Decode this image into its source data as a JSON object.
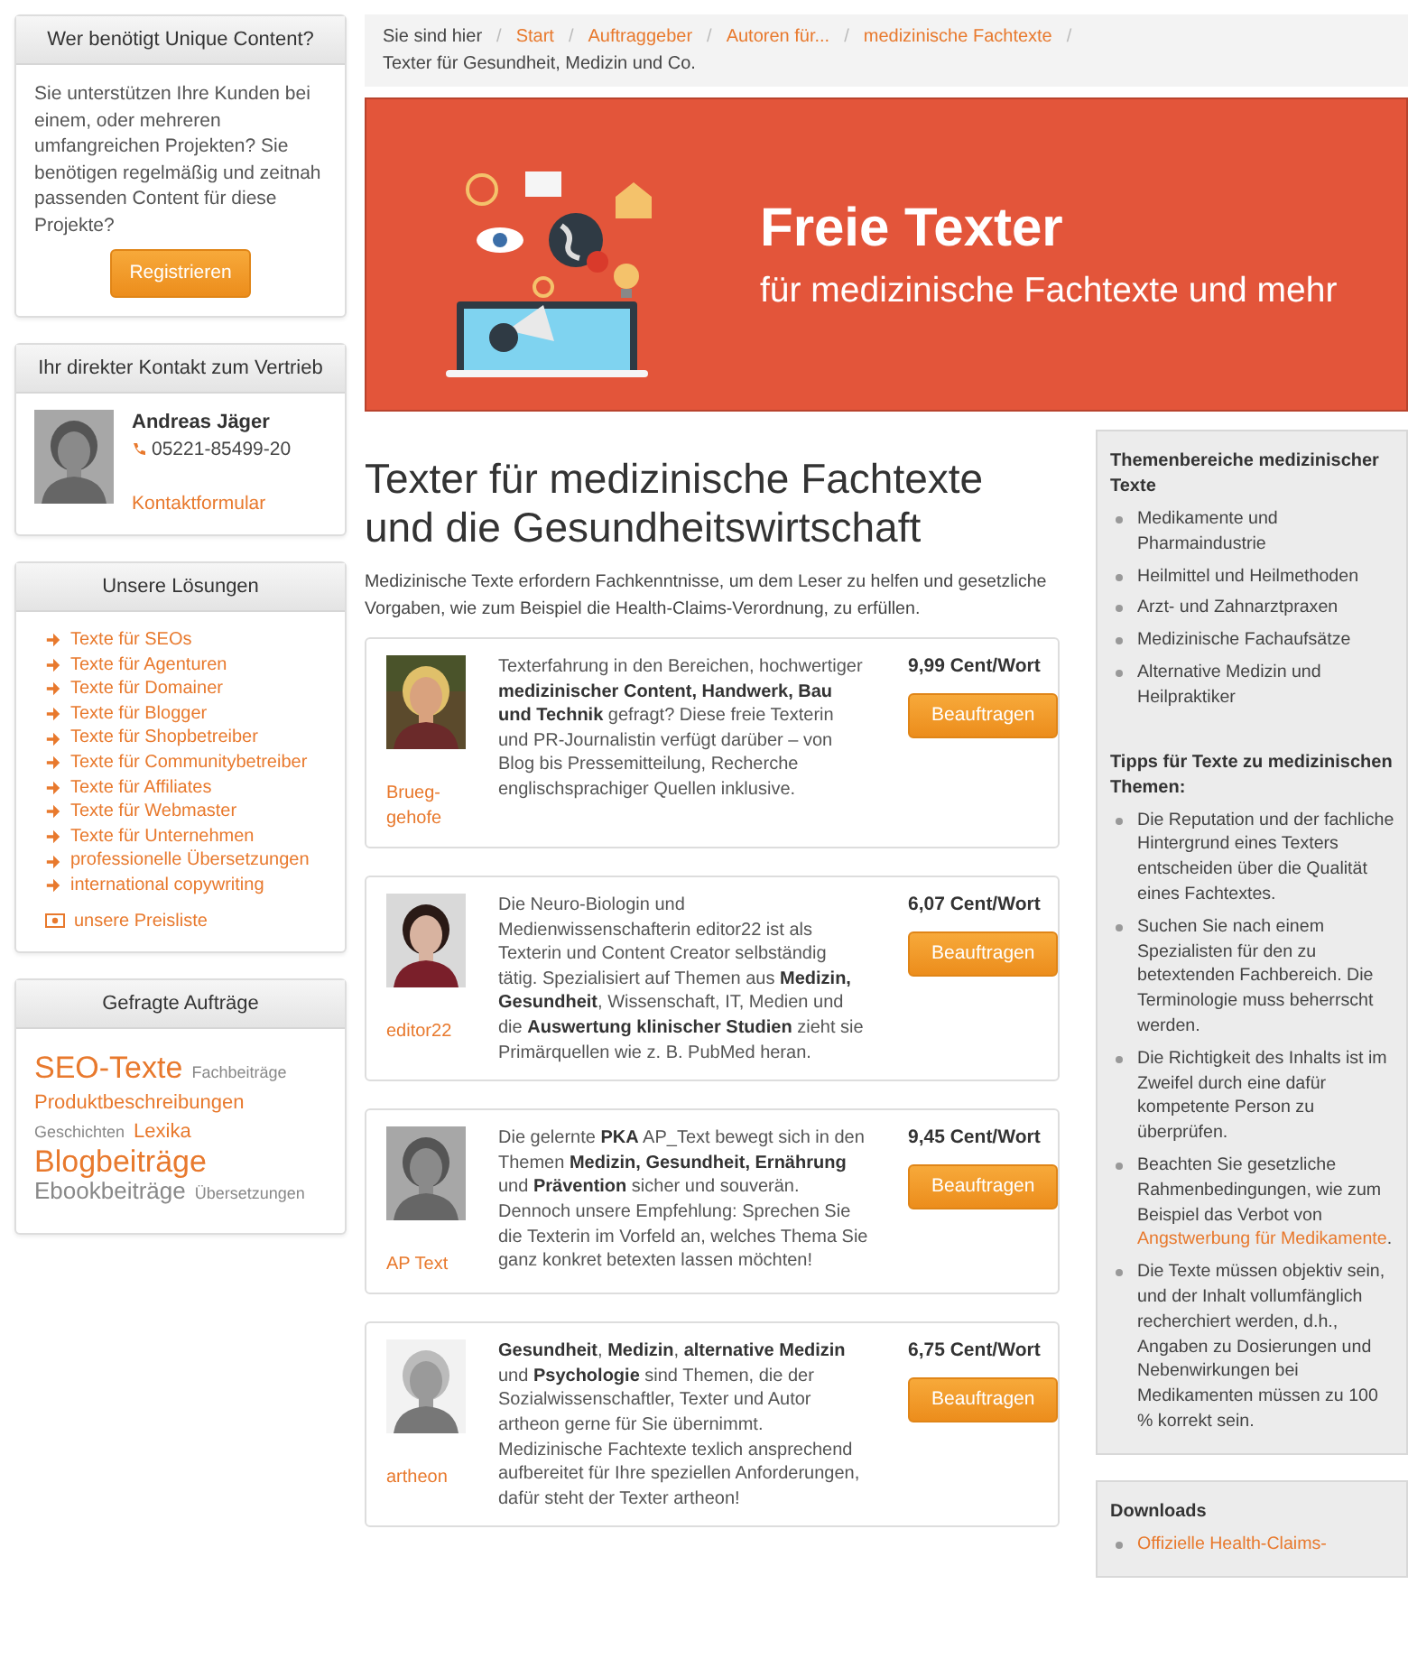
{
  "sidebar_panels": [
    {
      "kind": "promo",
      "title": "Wer benötigt Unique Content?",
      "text": "Sie unterstützen Ihre Kunden bei einem, oder mehreren umfangreichen Projekten? Sie benötigen regelmäßig und zeitnah passenden Content für diese Projekte?",
      "button": "Registrieren"
    },
    {
      "kind": "contact",
      "title": "Ihr direkter Kontakt zum Vertrieb",
      "name": "Andreas Jäger",
      "phone": "05221-85499-20",
      "link": "Kontaktformular"
    },
    {
      "kind": "links",
      "title": "Unsere Lösungen",
      "items": [
        {
          "kind": "arrow",
          "label": "Texte für SEOs"
        },
        {
          "kind": "arrow",
          "label": "Texte für Agenturen"
        },
        {
          "kind": "arrow",
          "label": "Texte für Domainer"
        },
        {
          "kind": "arrow",
          "label": "Texte für Blogger"
        },
        {
          "kind": "arrow",
          "label": "Texte für Shopbetreiber"
        },
        {
          "kind": "arrow",
          "label": "Texte für Communitybetreiber"
        },
        {
          "kind": "arrow",
          "label": "Texte für Affiliates"
        },
        {
          "kind": "arrow",
          "label": "Texte für Webmaster"
        },
        {
          "kind": "arrow",
          "label": "Texte für Unternehmen"
        },
        {
          "kind": "arrow",
          "label": "professionelle Übersetzungen"
        },
        {
          "kind": "arrow",
          "label": "international copywriting"
        },
        {
          "kind": "price",
          "label": "unsere Preisliste"
        }
      ]
    },
    {
      "kind": "tags",
      "title": "Gefragte Aufträge",
      "tags": [
        {
          "label": "SEO-Texte",
          "kind": "large",
          "color": "#e8792d"
        },
        {
          "label": "Fachbeiträge",
          "kind": "small",
          "color": "#888888"
        },
        {
          "label": "Produktbeschreibungen",
          "kind": "medium",
          "color": "#e8792d"
        },
        {
          "label": "Geschichten",
          "kind": "small",
          "color": "#888888"
        },
        {
          "label": "Lexika",
          "kind": "medium",
          "color": "#e8792d"
        },
        {
          "label": "Blogbeiträge",
          "kind": "large",
          "color": "#e8792d"
        },
        {
          "label": "Ebookbeiträge",
          "kind": "mediumlarge",
          "color": "#888888"
        },
        {
          "label": "Übersetzungen",
          "kind": "small",
          "color": "#888888"
        }
      ]
    }
  ],
  "breadcrumb": {
    "prefix": "Sie sind hier",
    "separator": "/",
    "items": [
      {
        "label": "Start",
        "current": false
      },
      {
        "label": "Auftraggeber",
        "current": false
      },
      {
        "label": "Autoren für...",
        "current": false
      },
      {
        "label": "medizinische Fachtexte",
        "current": false
      },
      {
        "label": "Texter für Gesundheit, Medizin und Co.",
        "current": true
      }
    ]
  },
  "banner": {
    "title": "Freie Texter",
    "subtitle": "für medizinische Fachtexte und mehr"
  },
  "heading": "Texter für medizinische Fachtexte und die Gesundheitswirtschaft",
  "intro": "Medizinische Texte erfordern Fachkenntnisse, um dem Leser zu helfen und gesetzliche Vorgaben, wie zum Beispiel die Health-Claims-Verordnung, zu erfüllen.",
  "writers": [
    {
      "name": "Brueg-gehofe",
      "text": "Texterfahrung in den Bereichen, hochwertiger **medizinischer Content, Handwerk, Bau und Technik** gefragt? Diese freie Texterin und PR-Journalistin verfügt darüber – von Blog bis Pressemitteilung, Recherche englischsprachiger Quellen inklusive.",
      "price": "9,99 Cent/Wort",
      "button": "Beauftragen"
    },
    {
      "name": "editor22",
      "text": "Die Neuro-Biologin und Medienwissenschafterin editor22 ist als Texterin und Content Creator selbständig tätig. Spezialisiert auf Themen aus **Medizin, Gesundheit**, Wissenschaft, IT, Medien und die **Auswertung klinischer Studien** zieht sie Primärquellen wie z. B. PubMed heran.",
      "price": "6,07 Cent/Wort",
      "button": "Beauftragen"
    },
    {
      "name": "AP Text",
      "text": "Die gelernte **PKA** AP_Text bewegt sich in den Themen **Medizin, Gesundheit, Ernährung** und **Prävention** sicher und souverän. Dennoch unsere Empfehlung: Sprechen Sie die Texterin im Vorfeld an, welches Thema Sie ganz konkret betexten lassen möchten!",
      "price": "9,45 Cent/Wort",
      "button": "Beauftragen"
    },
    {
      "name": "artheon",
      "text": "**Gesundheit**, **Medizin**, **alternative Medizin** und **Psychologie** sind Themen, die der Sozialwissenschaftler, Texter und Autor artheon gerne für Sie übernimmt. Medizinische Fachtexte texlich ansprechend aufbereitet für Ihre speziellen Anforderungen, dafür steht der Texter artheon!",
      "price": "6,75 Cent/Wort",
      "button": "Beauftragen"
    }
  ],
  "aside": {
    "sections": [
      {
        "title": "Themenbereiche medizinischer Texte",
        "items": [
          {
            "parts": [
              {
                "kind": "text",
                "text": "Medikamente und Pharmaindustrie"
              }
            ]
          },
          {
            "parts": [
              {
                "kind": "text",
                "text": "Heilmittel und Heilmethoden"
              }
            ]
          },
          {
            "parts": [
              {
                "kind": "text",
                "text": "Arzt- und Zahnarztpraxen"
              }
            ]
          },
          {
            "parts": [
              {
                "kind": "text",
                "text": "Medizinische Fachaufsätze"
              }
            ]
          },
          {
            "parts": [
              {
                "kind": "text",
                "text": "Alternative Medizin und Heilpraktiker"
              }
            ]
          }
        ]
      },
      {
        "title": "Tipps für Texte zu medizinischen Themen:",
        "items": [
          {
            "parts": [
              {
                "kind": "text",
                "text": "Die Reputation und der fachliche Hintergrund eines Texters entscheiden über die Qualität eines Fachtextes."
              }
            ]
          },
          {
            "parts": [
              {
                "kind": "text",
                "text": "Suchen Sie nach einem Spezialisten für den zu betextenden Fachbereich. Die Terminologie muss beherrscht werden."
              }
            ]
          },
          {
            "parts": [
              {
                "kind": "text",
                "text": "Die Richtigkeit des Inhalts ist im Zweifel durch eine dafür kompetente Person zu überprüfen."
              }
            ]
          },
          {
            "parts": [
              {
                "kind": "text",
                "text": "Beachten Sie gesetzliche Rahmenbedingungen, wie zum Beispiel das Verbot von "
              },
              {
                "kind": "link",
                "text": "Angstwerbung für Medikamente"
              },
              {
                "kind": "text",
                "text": "."
              }
            ]
          },
          {
            "parts": [
              {
                "kind": "text",
                "text": "Die Texte müssen objektiv sein, und der Inhalt vollumfänglich recherchiert werden, d.h., Angaben zu Dosierungen und Nebenwirkungen bei Medikamenten müssen zu 100 % korrekt sein."
              }
            ]
          }
        ]
      }
    ],
    "downloads": {
      "title": "Downloads",
      "items": [
        "Offizielle Health-Claims-"
      ]
    }
  }
}
